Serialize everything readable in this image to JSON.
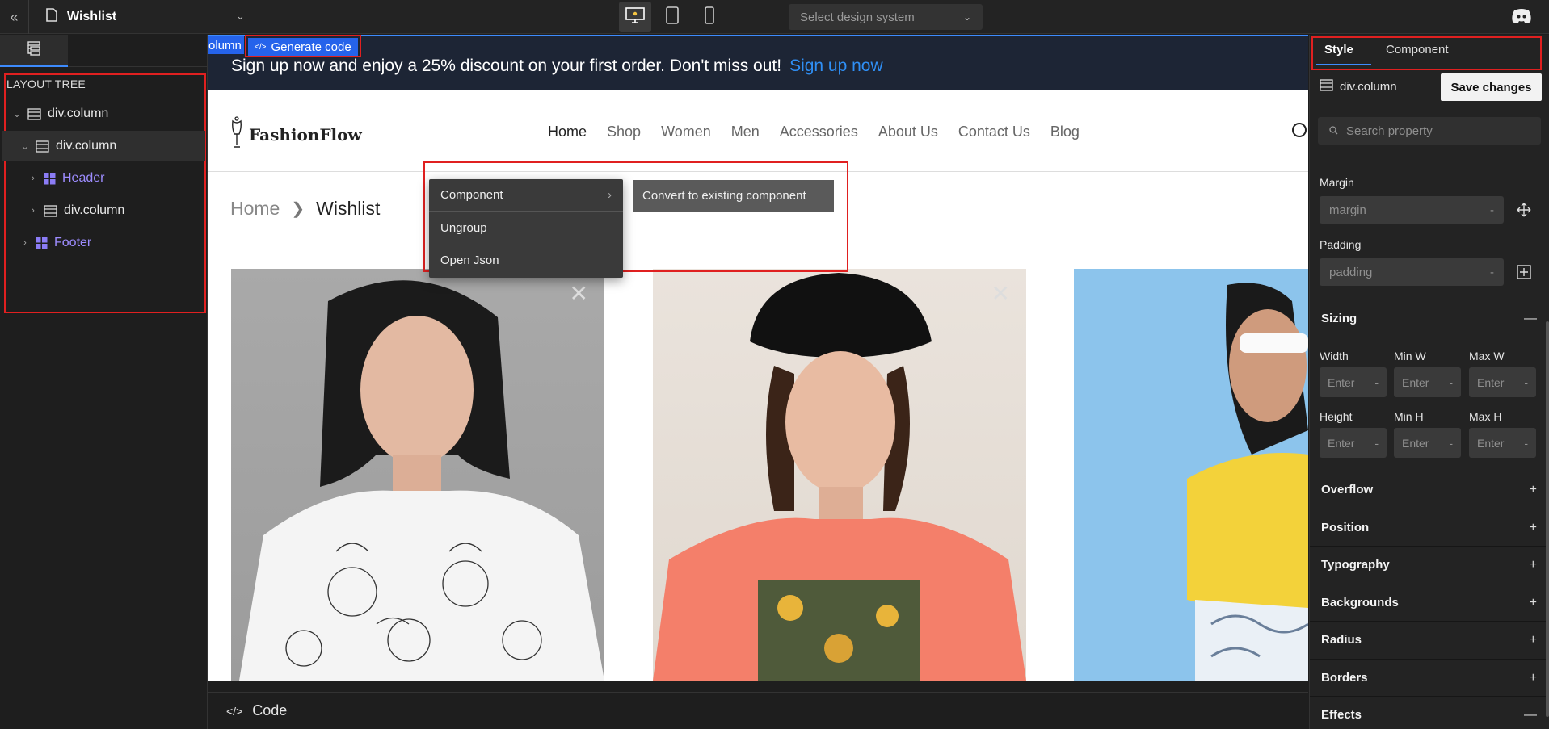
{
  "topbar": {
    "page_title": "Wishlist",
    "design_system_placeholder": "Select design system"
  },
  "layout_tree": {
    "heading": "LAYOUT TREE",
    "items": [
      {
        "label": "div.column"
      },
      {
        "label": "div.column"
      },
      {
        "label": "Header"
      },
      {
        "label": "div.column"
      },
      {
        "label": "Footer"
      }
    ]
  },
  "canvas": {
    "selection_tag": "olumn",
    "generate_code_label": "Generate code",
    "banner_text": "Sign up now and enjoy a 25% discount on your first order. Don't miss out!",
    "banner_link": "Sign up now",
    "logo_text": "FashionFlow",
    "nav": [
      "Home",
      "Shop",
      "Women",
      "Men",
      "Accessories",
      "About Us",
      "Contact Us",
      "Blog"
    ],
    "breadcrumb_home": "Home",
    "breadcrumb_current": "Wishlist"
  },
  "context_menu": {
    "items": [
      "Component",
      "Ungroup",
      "Open Json"
    ],
    "submenu_item": "Convert to existing component"
  },
  "codebar": {
    "label": "Code"
  },
  "right_panel": {
    "tab_style": "Style",
    "tab_component": "Component",
    "element_name": "div.column",
    "save_label": "Save changes",
    "search_placeholder": "Search property",
    "margin_label": "Margin",
    "margin_placeholder": "margin",
    "padding_label": "Padding",
    "padding_placeholder": "padding",
    "dash": "-",
    "sizing": {
      "title": "Sizing",
      "width": "Width",
      "min_w": "Min W",
      "max_w": "Max W",
      "height": "Height",
      "min_h": "Min H",
      "max_h": "Max H",
      "enter": "Enter"
    },
    "sections": [
      "Overflow",
      "Position",
      "Typography",
      "Backgrounds",
      "Radius",
      "Borders",
      "Effects"
    ]
  }
}
